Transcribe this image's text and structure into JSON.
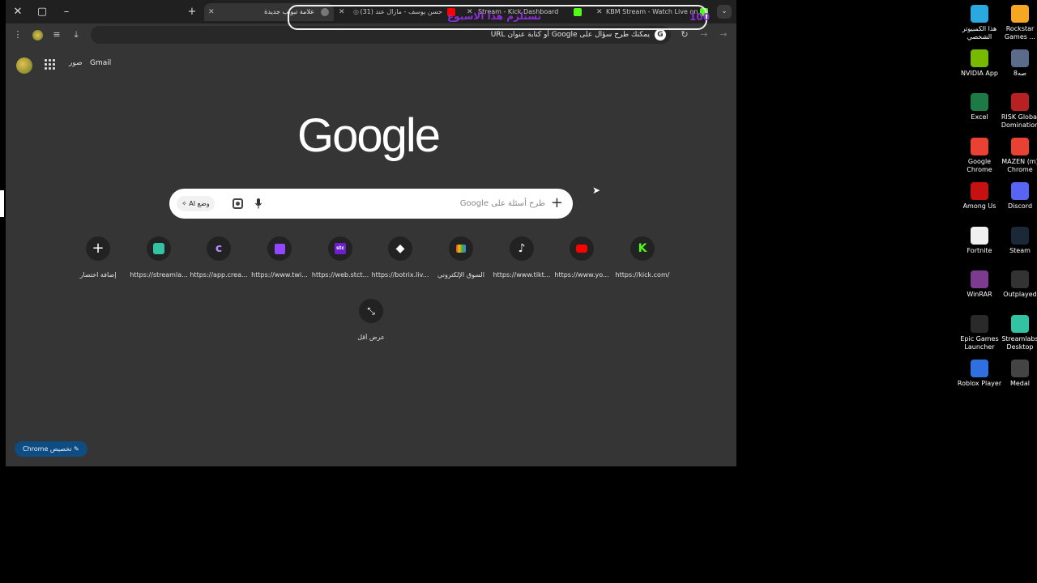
{
  "window": {
    "tabs": [
      {
        "label": "علامة تبويب جديدة",
        "active": true
      },
      {
        "label": "حسن يوسف - مازال عند (31)",
        "active": false
      },
      {
        "label": "Stream - Kick Dashboard",
        "active": false
      },
      {
        "label": "KBM Stream - Watch Live on",
        "active": false
      }
    ],
    "overlay_text": "تستلزم هذا الاسبوع",
    "overlay_number": "100"
  },
  "toolbar": {
    "omnibox_placeholder": "يمكنك طرح سؤال على Google أو كتابة عنوان URL"
  },
  "ntp": {
    "gmail": "Gmail",
    "images": "صور",
    "logo": "Google",
    "search_placeholder": "طرح أسئلة على Google",
    "ai_mode": "وضع AI",
    "shortcuts": [
      {
        "label": "https://kick.com/",
        "icon": "kick-icon",
        "color": "#53fc18"
      },
      {
        "label": "https://www.yo...",
        "icon": "youtube-icon",
        "color": "#ff0000"
      },
      {
        "label": "https://www.tikt...",
        "icon": "tiktok-icon",
        "color": "#ffffff"
      },
      {
        "label": "السوق الإلكتروني",
        "icon": "store-icon",
        "color": "#4285f4"
      },
      {
        "label": "https://botrix.liv...",
        "icon": "botrix-icon",
        "color": "#ffffff"
      },
      {
        "label": "https://web.stct...",
        "icon": "streamcity-icon",
        "color": "#6c1fd1"
      },
      {
        "label": "https://www.twi...",
        "icon": "twitch-icon",
        "color": "#9146ff"
      },
      {
        "label": "https://app.crea...",
        "icon": "create-icon",
        "color": "#7b3fe4"
      },
      {
        "label": "https://streamla...",
        "icon": "streamlabs-icon",
        "color": "#31c3a2"
      },
      {
        "label": "إضافة اختصار",
        "icon": "plus-icon",
        "color": "#ffffff"
      }
    ],
    "show_less": "عرض أقل",
    "customize": "تخصيص Chrome"
  },
  "desktop": [
    {
      "label": "هذا الكمبيوتر الشخصي",
      "color": "#2aa8e0"
    },
    {
      "label": "Rockstar Games ...",
      "color": "#f5a623"
    },
    {
      "label": "NVIDIA App",
      "color": "#76b900"
    },
    {
      "label": "8صه",
      "color": "#5b6b8a"
    },
    {
      "label": "Excel",
      "color": "#1d7a45"
    },
    {
      "label": "RISK Global Domination",
      "color": "#b82121"
    },
    {
      "label": "Google Chrome",
      "color": "#e94235"
    },
    {
      "label": "MAZEN (m) Chrome",
      "color": "#e94235"
    },
    {
      "label": "Among Us",
      "color": "#c51111"
    },
    {
      "label": "Discord",
      "color": "#5865f2"
    },
    {
      "label": "Fortnite",
      "color": "#f0f0f0"
    },
    {
      "label": "Steam",
      "color": "#1b2838"
    },
    {
      "label": "WinRAR",
      "color": "#7c3b8e"
    },
    {
      "label": "Outplayed",
      "color": "#333333"
    },
    {
      "label": "Epic Games Launcher",
      "color": "#2a2a2a"
    },
    {
      "label": "Streamlabs Desktop",
      "color": "#31c3a2"
    },
    {
      "label": "Roblox Player",
      "color": "#2f6fe0"
    },
    {
      "label": "Medal",
      "color": "#444444"
    }
  ]
}
